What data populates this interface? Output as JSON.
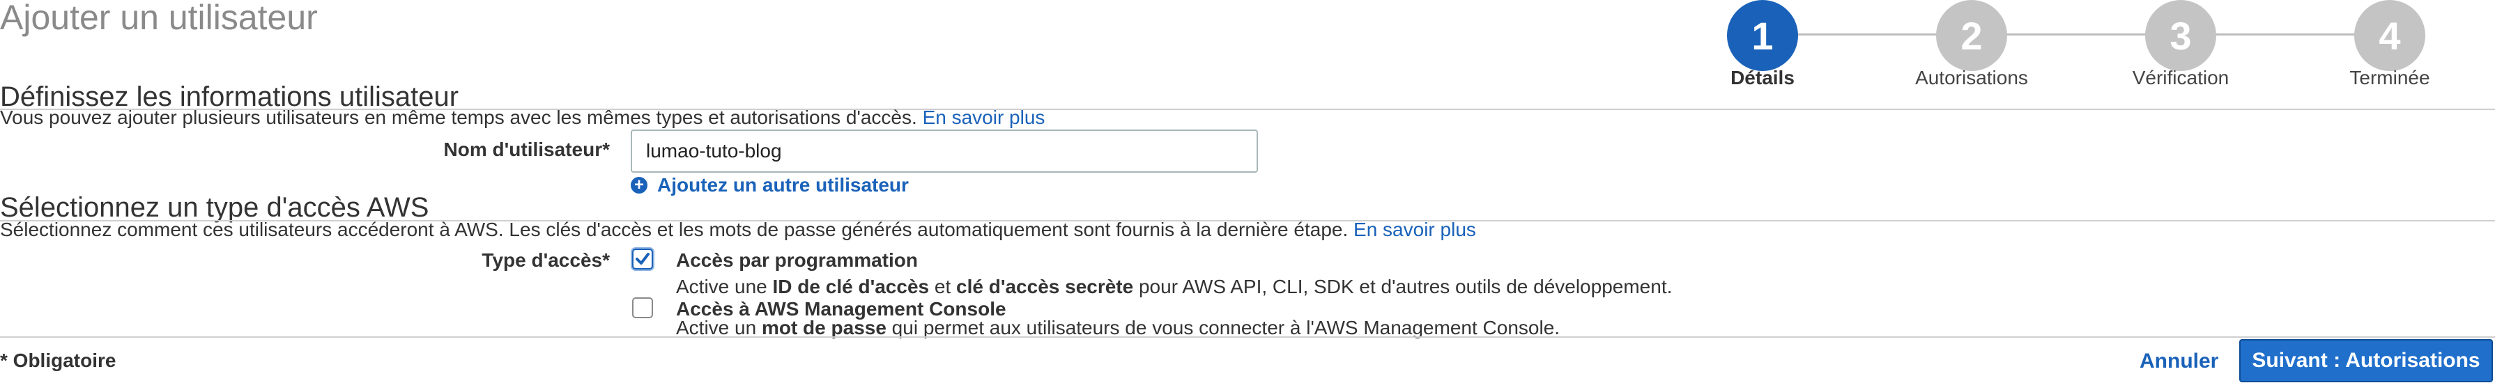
{
  "page_title": "Ajouter un utilisateur",
  "stepper": {
    "steps": [
      {
        "number": "1",
        "label": "Détails",
        "active": true
      },
      {
        "number": "2",
        "label": "Autorisations",
        "active": false
      },
      {
        "number": "3",
        "label": "Vérification",
        "active": false
      },
      {
        "number": "4",
        "label": "Terminée",
        "active": false
      }
    ]
  },
  "user_details": {
    "heading": "Définissez les informations utilisateur",
    "description": "Vous pouvez ajouter plusieurs utilisateurs en même temps avec les mêmes types et autorisations d'accès.",
    "learn_more": "En savoir plus",
    "username_label": "Nom d'utilisateur*",
    "username_value": "lumao-tuto-blog",
    "add_user_label": "Ajoutez un autre utilisateur"
  },
  "access_type": {
    "heading": "Sélectionnez un type d'accès AWS",
    "description": "Sélectionnez comment ces utilisateurs accéderont à AWS. Les clés d'accès et les mots de passe générés automatiquement sont fournis à la dernière étape.",
    "learn_more": "En savoir plus",
    "field_label": "Type d'accès*",
    "options": [
      {
        "title": "Accès par programmation",
        "checked": true,
        "desc_1": "Active une ",
        "desc_bold_1": "ID de clé d'accès",
        "desc_2": " et ",
        "desc_bold_2": "clé d'accès secrète",
        "desc_3": " pour AWS API, CLI, SDK et d'autres outils de développement."
      },
      {
        "title": "Accès à AWS Management Console",
        "checked": false,
        "desc_1": "Active un ",
        "desc_bold_1": "mot de passe",
        "desc_2": " qui permet aux utilisateurs de vous connecter à l'AWS Management Console."
      }
    ]
  },
  "footer": {
    "required_note": "* Obligatoire",
    "cancel_label": "Annuler",
    "next_label": "Suivant : Autorisations"
  },
  "colors": {
    "accent": "#1a62b9",
    "step_inactive": "#c4c4c4"
  }
}
